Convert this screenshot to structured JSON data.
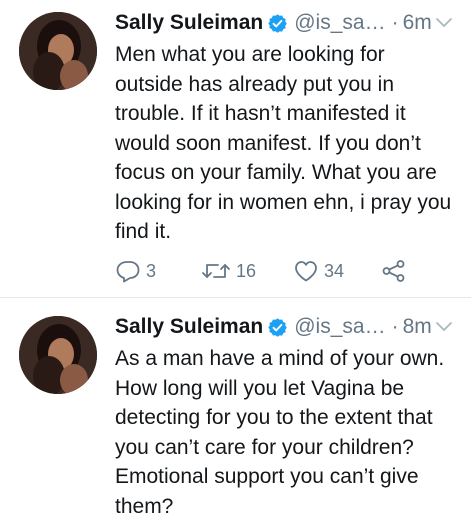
{
  "tweets": [
    {
      "name": "Sally Suleiman",
      "handle": "@is_sa…",
      "dot": "·",
      "time": "6m",
      "text": "Men what you are looking for\noutside has already put you in\ntrouble. If it hasn’t manifested it\nwould soon manifest. If you don’t\nfocus on your family. What you are\nlooking for in women ehn, i pray you\nfind it.",
      "replies": "3",
      "retweets": "16",
      "likes": "34",
      "icons": [
        "avatar",
        "verified-badge-icon",
        "chevron-down-icon",
        "reply-icon",
        "retweet-icon",
        "like-icon",
        "share-icon"
      ]
    },
    {
      "name": "Sally Suleiman",
      "handle": "@is_sa…",
      "dot": "·",
      "time": "8m",
      "text": "As a man have a mind of your own.\nHow long will you let Vagina be\ndetecting for you to the extent that\nyou can’t care for your children?\nEmotional support you can’t give\nthem?",
      "icons": [
        "avatar",
        "verified-badge-icon",
        "chevron-down-icon"
      ]
    }
  ],
  "colors": {
    "text": "#14171a",
    "secondary": "#657786",
    "verified": "#1da1f2",
    "divider": "#e1e8ed"
  }
}
